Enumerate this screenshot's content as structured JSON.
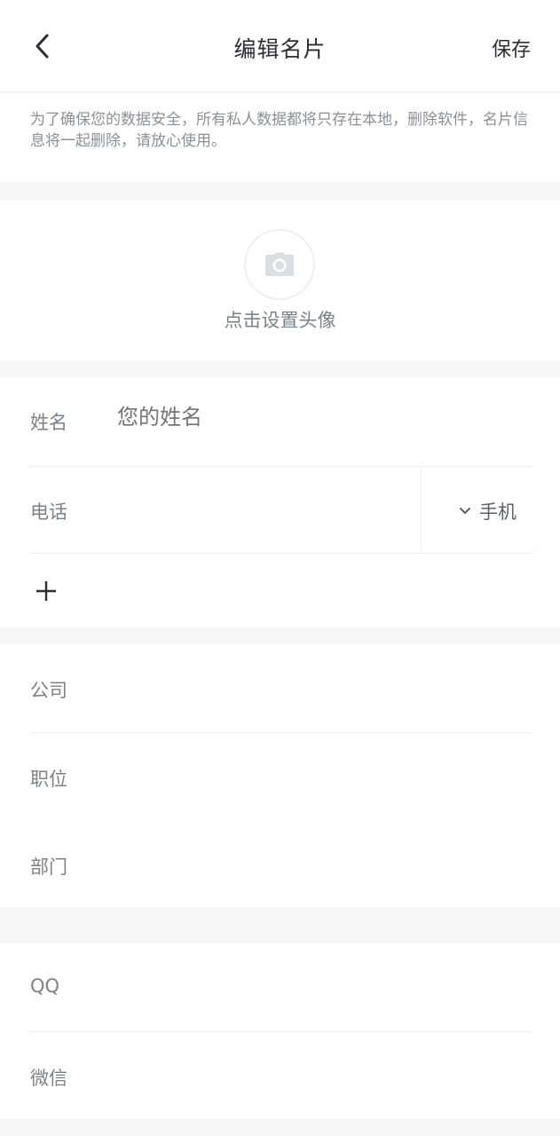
{
  "header": {
    "title": "编辑名片",
    "save_label": "保存"
  },
  "notice": {
    "text": "为了确保您的数据安全，所有私人数据都将只存在本地，删除软件，名片信息将一起删除，请放心使用。"
  },
  "avatar": {
    "label": "点击设置头像"
  },
  "name": {
    "label": "姓名",
    "placeholder": "您的姓名"
  },
  "phone": {
    "label": "电话",
    "type_label": "手机"
  },
  "company": {
    "label": "公司"
  },
  "position": {
    "label": "职位"
  },
  "department": {
    "label": "部门"
  },
  "qq": {
    "label": "QQ"
  },
  "wechat": {
    "label": "微信"
  }
}
